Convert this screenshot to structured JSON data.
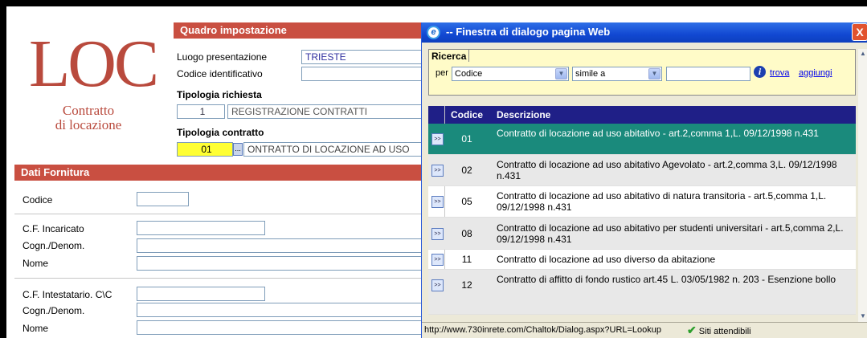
{
  "logo": {
    "text": "LOC",
    "sub1": "Contratto",
    "sub2": "di locazione"
  },
  "quadro": {
    "header": "Quadro impostazione",
    "luogo_label": "Luogo presentazione",
    "luogo_value": "TRIESTE",
    "codice_label": "Codice identificativo",
    "codice_value": "",
    "richiesta_label": "Tipologia richiesta",
    "richiesta_code": "1",
    "richiesta_desc": "REGISTRAZIONE CONTRATTI",
    "contratto_label": "Tipologia contratto",
    "contratto_code": "01",
    "contratto_btn": "...",
    "contratto_desc": "ONTRATTO DI LOCAZIONE AD USO"
  },
  "fornitura": {
    "header": "Dati Fornitura",
    "codice_label": "Codice",
    "cf_incaricato_label": "C.F. Incaricato",
    "cognome1_label": "Cogn./Denom.",
    "nome1_label": "Nome",
    "cf_intestatario_label": "C.F. Intestatario. C\\C",
    "cognome2_label": "Cogn./Denom.",
    "nome2_label": "Nome"
  },
  "dialog": {
    "title": "-- Finestra di dialogo pagina Web",
    "ie_icon": "e",
    "close": "X",
    "ricerca_label": "Ricerca",
    "per_label": "per",
    "field_select": "Codice",
    "op_select": "simile a",
    "search_value": "",
    "trova_link": "trova",
    "aggiungi_link": "aggiungi",
    "grid_headers": {
      "codice": "Codice",
      "descrizione": "Descrizione"
    },
    "rows": [
      {
        "code": "01",
        "desc": "Contratto di locazione ad uso abitativo - art.2,comma 1,L. 09/12/1998 n.431"
      },
      {
        "code": "02",
        "desc": "Contratto di locazione ad uso abitativo Agevolato - art.2,comma 3,L. 09/12/1998 n.431"
      },
      {
        "code": "05",
        "desc": "Contratto di locazione ad uso abitativo di natura transitoria - art.5,comma 1,L. 09/12/1998 n.431"
      },
      {
        "code": "08",
        "desc": "Contratto di locazione ad uso abitativo per studenti universitari - art.5,comma 2,L. 09/12/1998 n.431"
      },
      {
        "code": "11",
        "desc": "Contratto di locazione ad uso diverso da abitazione"
      },
      {
        "code": "12",
        "desc": "Contratto di affitto di fondo rustico art.45 L. 03/05/1982 n. 203 - Esenzione bollo"
      }
    ],
    "row_button": ">>",
    "status_url": "http://www.730inrete.com/Chaltok/Dialog.aspx?URL=Lookup",
    "status_trust": "Siti attendibili"
  },
  "colors": {
    "accent": "#c94f41",
    "grid_header": "#1f1f87",
    "selected_row": "#1a8a7c"
  }
}
